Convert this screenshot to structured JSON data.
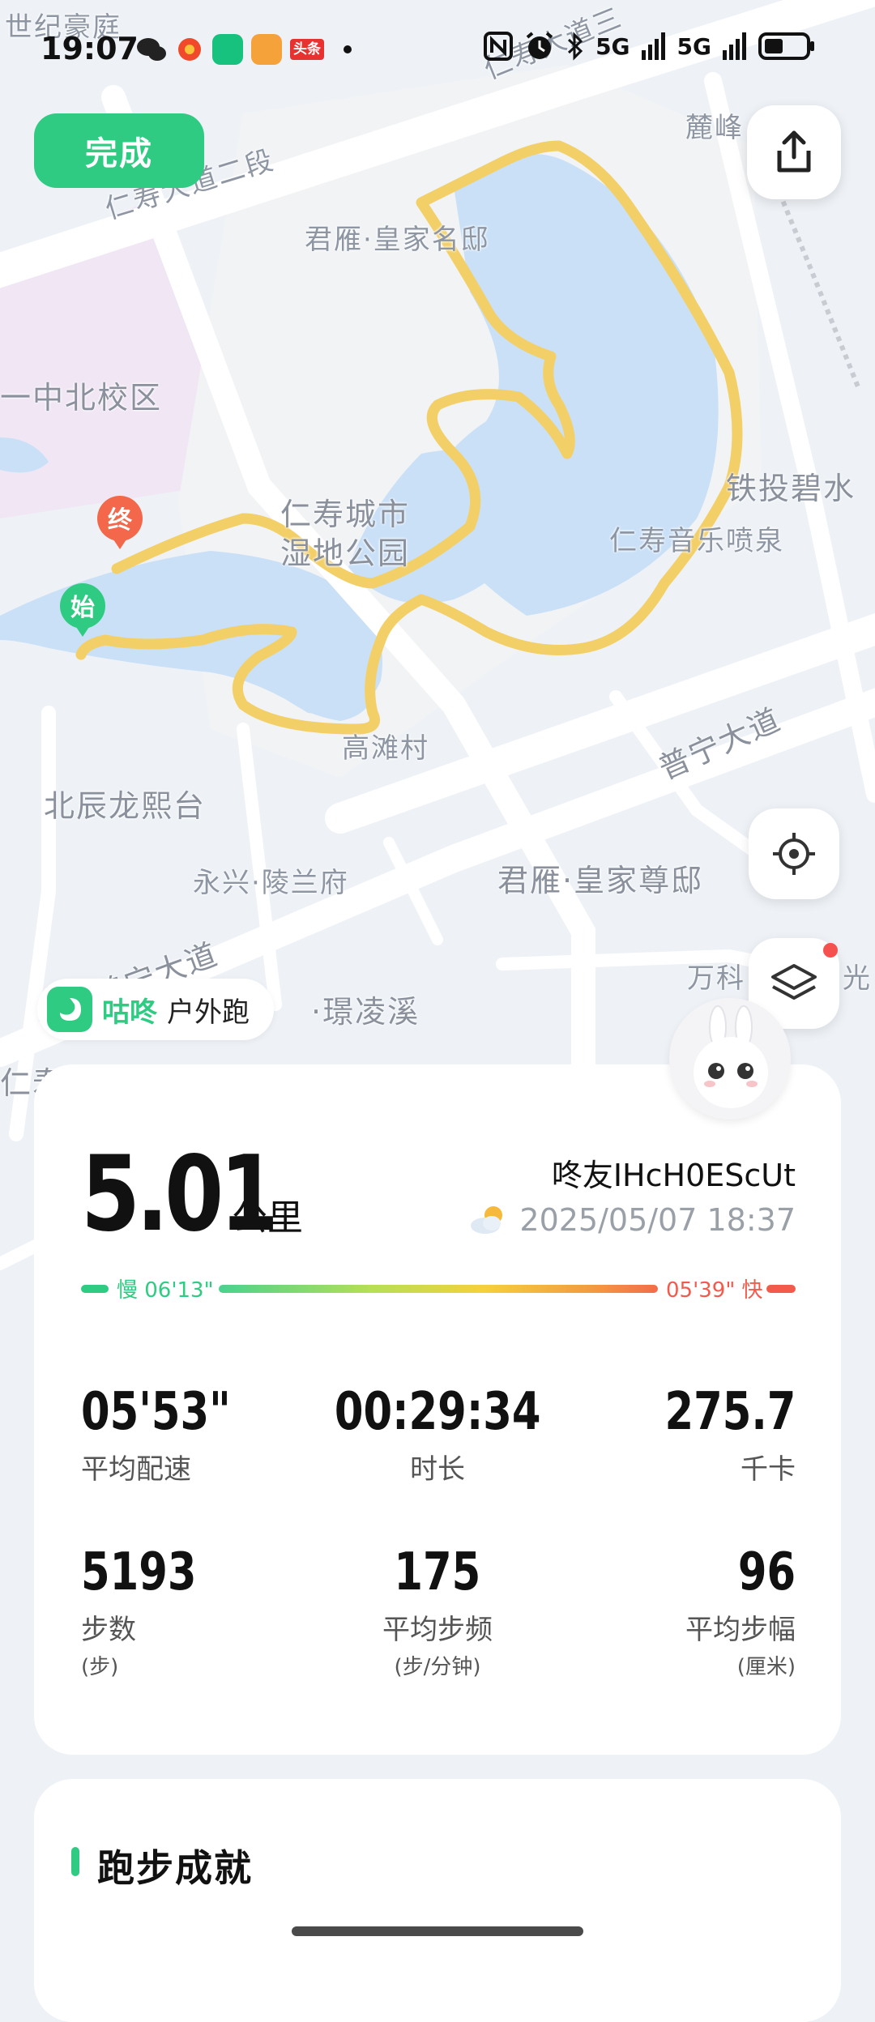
{
  "status_bar": {
    "time": "19:07",
    "signal1": "5G",
    "signal2": "5G",
    "app_icons": [
      "wechat-icon",
      "app-orange-icon",
      "app-green-icon",
      "app-video-icon",
      "toutiao-icon"
    ],
    "toutiao_text": "头条"
  },
  "top": {
    "done_label": "完成"
  },
  "map": {
    "labels": {
      "estate_top": "世纪豪庭",
      "road_top": "仁寿大道二段",
      "road_top2": "仁寿大道三",
      "mansion": "君雁·皇家名邸",
      "school": "一中北校区",
      "park": "仁寿城市",
      "park2": "湿地公园",
      "fountain": "仁寿音乐喷泉",
      "tower": "铁投碧水",
      "village": "高滩村",
      "road_mid": "普宁大道",
      "north_star": "北辰龙熙台",
      "yongxing": "永兴·陵兰府",
      "junyan2": "君雁·皇家尊邸",
      "road_low": "普宁大道",
      "wanke": "万科",
      "guang": "光",
      "jinglingxi": "·璟凌溪",
      "lufeng": "麓峰",
      "renshou_low": "仁寿"
    },
    "start_marker": "始",
    "end_marker": "终"
  },
  "brand": {
    "name": "咕咚",
    "subtitle": "户外跑"
  },
  "stats": {
    "distance": "5.01",
    "distance_unit": "公里",
    "username": "咚友IHcH0EScUt",
    "datetime": "2025/05/07 18:37",
    "pace_slow": "慢 06'13\"",
    "pace_fast": "05'39\" 快",
    "avg_pace": "05'53\"",
    "avg_pace_label": "平均配速",
    "duration": "00:29:34",
    "duration_label": "时长",
    "calories": "275.7",
    "calories_label": "千卡",
    "steps": "5193",
    "steps_label": "步数",
    "steps_unit": "(步)",
    "cadence": "175",
    "cadence_label": "平均步频",
    "cadence_unit": "(步/分钟)",
    "stride": "96",
    "stride_label": "平均步幅",
    "stride_unit": "(厘米)"
  },
  "achievements": {
    "title": "跑步成就"
  },
  "colors": {
    "accent": "#2fcb82",
    "route": "#f3cf67",
    "water": "#c9e0f7",
    "fast": "#f25b4b"
  }
}
